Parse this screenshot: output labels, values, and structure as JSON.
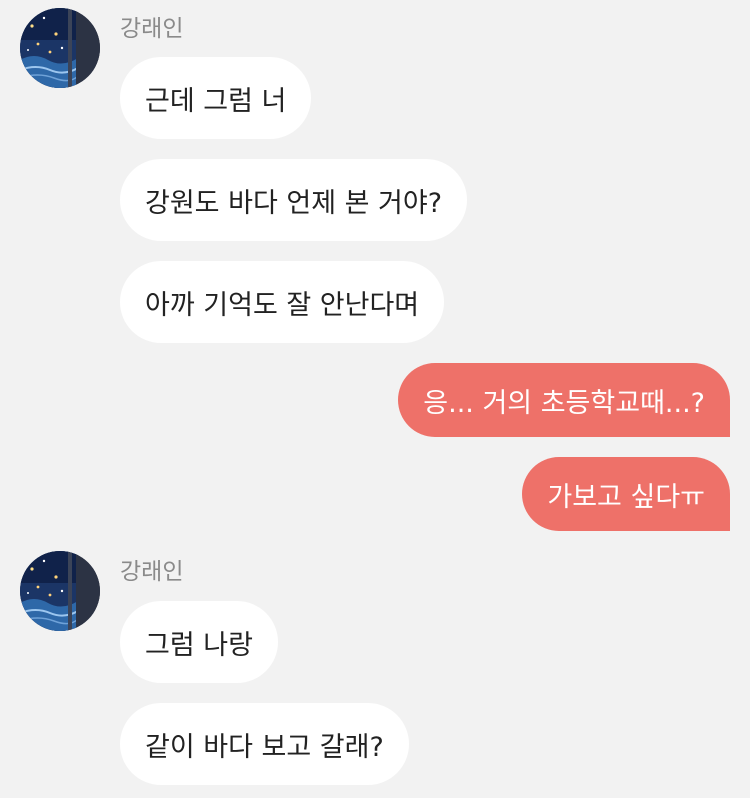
{
  "colors": {
    "background": "#f2f2f2",
    "incoming_bubble": "#ffffff",
    "outgoing_bubble": "#ee7169",
    "sender_name": "#8a8a8a"
  },
  "chat": {
    "groups": [
      {
        "sender": "강래인",
        "avatar_icon": "profile-photo-night-sea-icon",
        "messages": [
          "근데 그럼 너",
          "강원도 바다 언제 본 거야?",
          "아까 기억도 잘 안난다며"
        ]
      },
      {
        "sender": "me",
        "messages": [
          "응... 거의 초등학교때...?",
          "가보고 싶다ㅠ"
        ]
      },
      {
        "sender": "강래인",
        "avatar_icon": "profile-photo-night-sea-icon",
        "messages": [
          "그럼 나랑",
          "같이 바다 보고 갈래?"
        ]
      }
    ]
  }
}
